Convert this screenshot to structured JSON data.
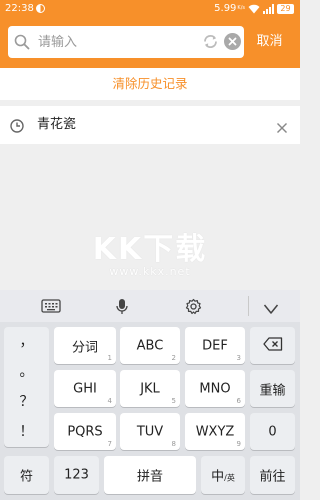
{
  "status_bar": {
    "time": "22:38",
    "network_speed": "5.99",
    "network_unit": "K/s",
    "battery": "29"
  },
  "search": {
    "placeholder": "请输入",
    "cancel_label": "取消"
  },
  "history": {
    "clear_label": "清除历史记录",
    "items": [
      "青花瓷"
    ]
  },
  "watermark": {
    "logo": "KK下载",
    "url": "www.kkx.net"
  },
  "keyboard": {
    "punctuation": [
      "，",
      "。",
      "？",
      "！"
    ],
    "rows": [
      [
        {
          "label": "分词",
          "num": "1"
        },
        {
          "label": "ABC",
          "num": "2"
        },
        {
          "label": "DEF",
          "num": "3"
        }
      ],
      [
        {
          "label": "GHI",
          "num": "4"
        },
        {
          "label": "JKL",
          "num": "5"
        },
        {
          "label": "MNO",
          "num": "6"
        }
      ],
      [
        {
          "label": "PQRS",
          "num": "7"
        },
        {
          "label": "TUV",
          "num": "8"
        },
        {
          "label": "WXYZ",
          "num": "9"
        }
      ]
    ],
    "reinput_label": "重输",
    "zero_label": "0",
    "symbol_label": "符",
    "num_switch_label": "123",
    "space_label": "拼音",
    "lang_main": "中",
    "lang_sub": "/英",
    "go_label": "前往",
    "icons": [
      "keyboard-icon",
      "microphone-icon",
      "gear-icon",
      "hide-keyboard-icon",
      "backspace-icon"
    ]
  },
  "colors": {
    "accent": "#f7902a",
    "background": "#efefef",
    "keyboard_bg": "#dfe1e5"
  }
}
